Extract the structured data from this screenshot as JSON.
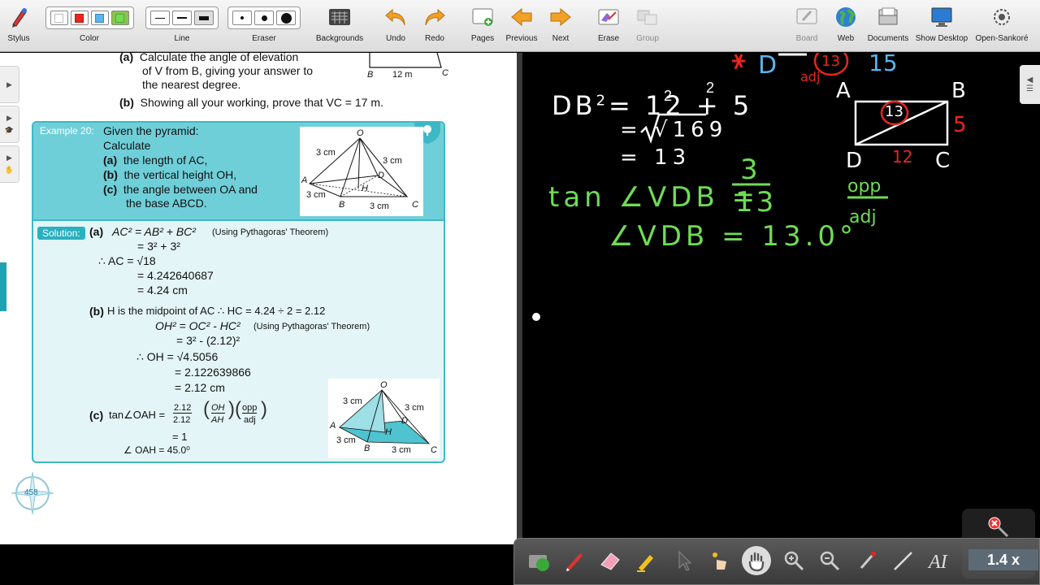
{
  "toolbar": {
    "stylus": "Stylus",
    "color": "Color",
    "line": "Line",
    "eraser": "Eraser",
    "backgrounds": "Backgrounds",
    "undo": "Undo",
    "redo": "Redo",
    "pages": "Pages",
    "previous": "Previous",
    "next": "Next",
    "erase": "Erase",
    "group": "Group",
    "board": "Board",
    "web": "Web",
    "documents": "Documents",
    "show_desktop": "Show Desktop",
    "open_sankore": "Open-Sankoré",
    "colors": [
      "#ffffff",
      "#e8261d",
      "#5ab4f0",
      "#6fdc54"
    ]
  },
  "textbook": {
    "q_a_1": "Calculate the angle of elevation",
    "q_a_2": "of V from B, giving your answer to",
    "q_a_3": "the nearest degree.",
    "q_b": "Showing all your working, prove that VC = 17 m.",
    "label_a": "(a)",
    "label_b": "(b)",
    "top_fig_b": "B",
    "top_fig_12m": "12 m",
    "top_fig_c": "C",
    "example_label": "Example 20:",
    "example_title": "Given the pyramid:",
    "example_calc": "Calculate",
    "parts": [
      {
        "label": "(a)",
        "text": "the length of AC,"
      },
      {
        "label": "(b)",
        "text": "the vertical height OH,"
      },
      {
        "label": "(c)",
        "text": "the angle between OA and"
      }
    ],
    "part_c_cont": "the base ABCD.",
    "solution_label": "Solution:",
    "sol_a_label": "(a)",
    "sol_a_1": "AC² = AB² + BC²",
    "sol_a_1_note": "(Using Pythagoras' Theorem)",
    "sol_a_2": "= 3² + 3²",
    "sol_a_3": "∴  AC = √18",
    "sol_a_4": "= 4.242640687",
    "sol_a_5": "= 4.24 cm",
    "sol_b_label": "(b)",
    "sol_b_1": "H is the midpoint of AC  ∴  HC = 4.24 ÷ 2 = 2.12",
    "sol_b_2": "OH² = OC² - HC²",
    "sol_b_2_note": "(Using Pythagoras' Theorem)",
    "sol_b_3": "= 3² - (2.12)²",
    "sol_b_4": "∴  OH = √4.5056",
    "sol_b_5": "= 2.122639866",
    "sol_b_6": "= 2.12 cm",
    "sol_c_label": "(c)",
    "sol_c_1": "tan∠OAH =",
    "sol_c_frac_num": "2.12",
    "sol_c_frac_den": "2.12",
    "sol_c_oh": "OH",
    "sol_c_ah": "AH",
    "sol_c_opp": "opp",
    "sol_c_adj": "adj",
    "sol_c_2": "= 1",
    "sol_c_3": "∠ OAH = 45.0⁰",
    "fig_o": "O",
    "fig_a": "A",
    "fig_b": "B",
    "fig_c": "C",
    "fig_d": "D",
    "fig_h": "H",
    "fig_3cm": "3 cm",
    "page_number": "458"
  },
  "board": {
    "db_eq_1": "DB",
    "db_eq_1b": "= 12  + 5",
    "db_eq_2": "= √169",
    "db_eq_3": "= 13",
    "tan_line": "tan ∠VDB =",
    "frac_num": "3",
    "frac_den": "13",
    "angle_line": "∠VDB = 13.0°",
    "opp_adj_1": "opp",
    "opp_adj_2": "adj",
    "rect_a": "A",
    "rect_b": "B",
    "rect_c": "C",
    "rect_d": "D",
    "rect_13": "13",
    "rect_5": "5",
    "rect_12": "12",
    "top_adj": "adj",
    "top_13": "13",
    "top_15": "15",
    "top_d": "D"
  },
  "dock": {
    "zoom": "1.4 x"
  }
}
